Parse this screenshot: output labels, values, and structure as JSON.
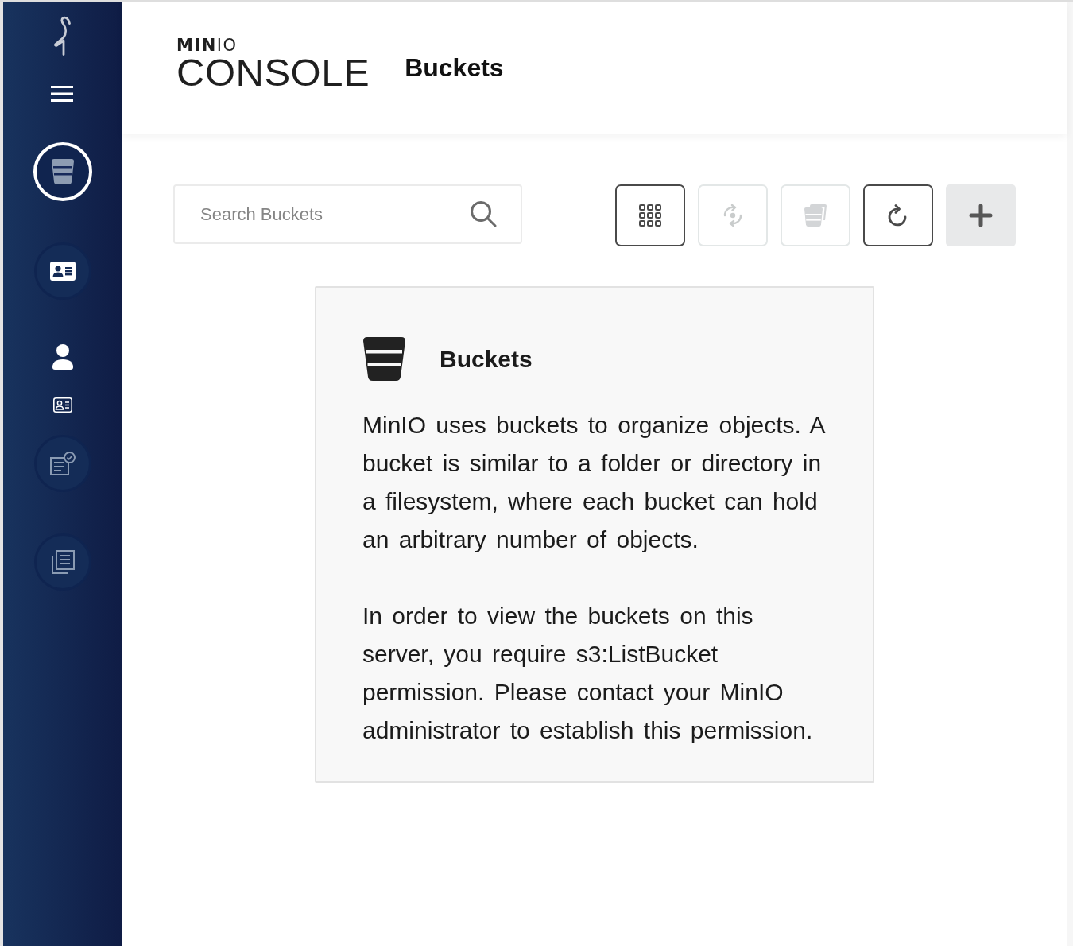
{
  "sidebar": {
    "items": [
      {
        "kind": "buckets",
        "selected": true
      },
      {
        "kind": "identity",
        "selected": false
      },
      {
        "kind": "user",
        "selected": false
      },
      {
        "kind": "id-card",
        "selected": false
      },
      {
        "kind": "policy",
        "selected": false
      },
      {
        "kind": "documentation",
        "selected": false
      }
    ]
  },
  "header": {
    "logo": {
      "brand": "**MIN**IO",
      "product": "CONSOLE"
    },
    "title": "Buckets"
  },
  "toolbar": {
    "search": {
      "placeholder": "Search Buckets"
    },
    "buttons": [
      {
        "kind": "grid",
        "disabled": false
      },
      {
        "kind": "rewind",
        "disabled": true
      },
      {
        "kind": "bulk",
        "disabled": true
      },
      {
        "kind": "refresh",
        "disabled": false
      },
      {
        "kind": "add",
        "disabled": false
      }
    ]
  },
  "info_card": {
    "title": "Buckets",
    "paragraphs": [
      "MinIO uses buckets to organize objects. A bucket is similar to a folder or directory in a filesystem, where each bucket can hold an arbitrary number of objects.",
      "In order to view the buckets on this server, you require s3:ListBucket permission. Please contact your MinIO administrator to establish this permission."
    ]
  }
}
